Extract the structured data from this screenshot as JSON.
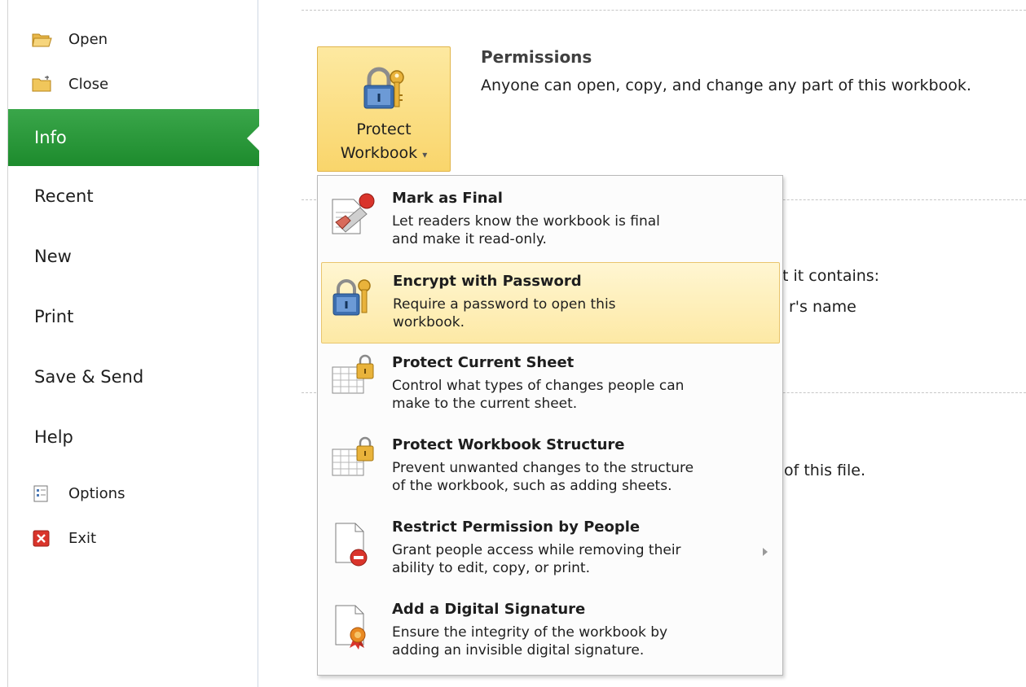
{
  "sidebar": {
    "open_label": "Open",
    "close_label": "Close",
    "info_label": "Info",
    "recent_label": "Recent",
    "new_label": "New",
    "print_label": "Print",
    "save_send_label": "Save & Send",
    "help_label": "Help",
    "options_label": "Options",
    "exit_label": "Exit"
  },
  "protect_button": {
    "line1": "Protect",
    "line2": "Workbook",
    "chevron": "▾"
  },
  "permissions": {
    "title": "Permissions",
    "description": "Anyone can open, copy, and change any part of this workbook."
  },
  "background_fragments": {
    "contains": "t it contains:",
    "name": "r's name",
    "file": "of this file."
  },
  "menu": {
    "items": [
      {
        "title": "Mark as Final",
        "line1": "Let readers know the workbook is final",
        "line2": "and make it read-only."
      },
      {
        "title": "Encrypt with Password",
        "line1": "Require a password to open this",
        "line2": "workbook."
      },
      {
        "title": "Protect Current Sheet",
        "line1": "Control what types of changes people can",
        "line2": "make to the current sheet."
      },
      {
        "title": "Protect Workbook Structure",
        "line1": "Prevent unwanted changes to the structure",
        "line2": "of the workbook, such as adding sheets."
      },
      {
        "title": "Restrict Permission by People",
        "line1": "Grant people access while removing their",
        "line2": "ability to edit, copy, or print."
      },
      {
        "title": "Add a Digital Signature",
        "line1": "Ensure the integrity of the workbook by",
        "line2": "adding an invisible digital signature."
      }
    ]
  },
  "colors": {
    "info_tab": "#1d8b2d",
    "highlight": "#fde9a5",
    "button": "#f9d56b"
  }
}
